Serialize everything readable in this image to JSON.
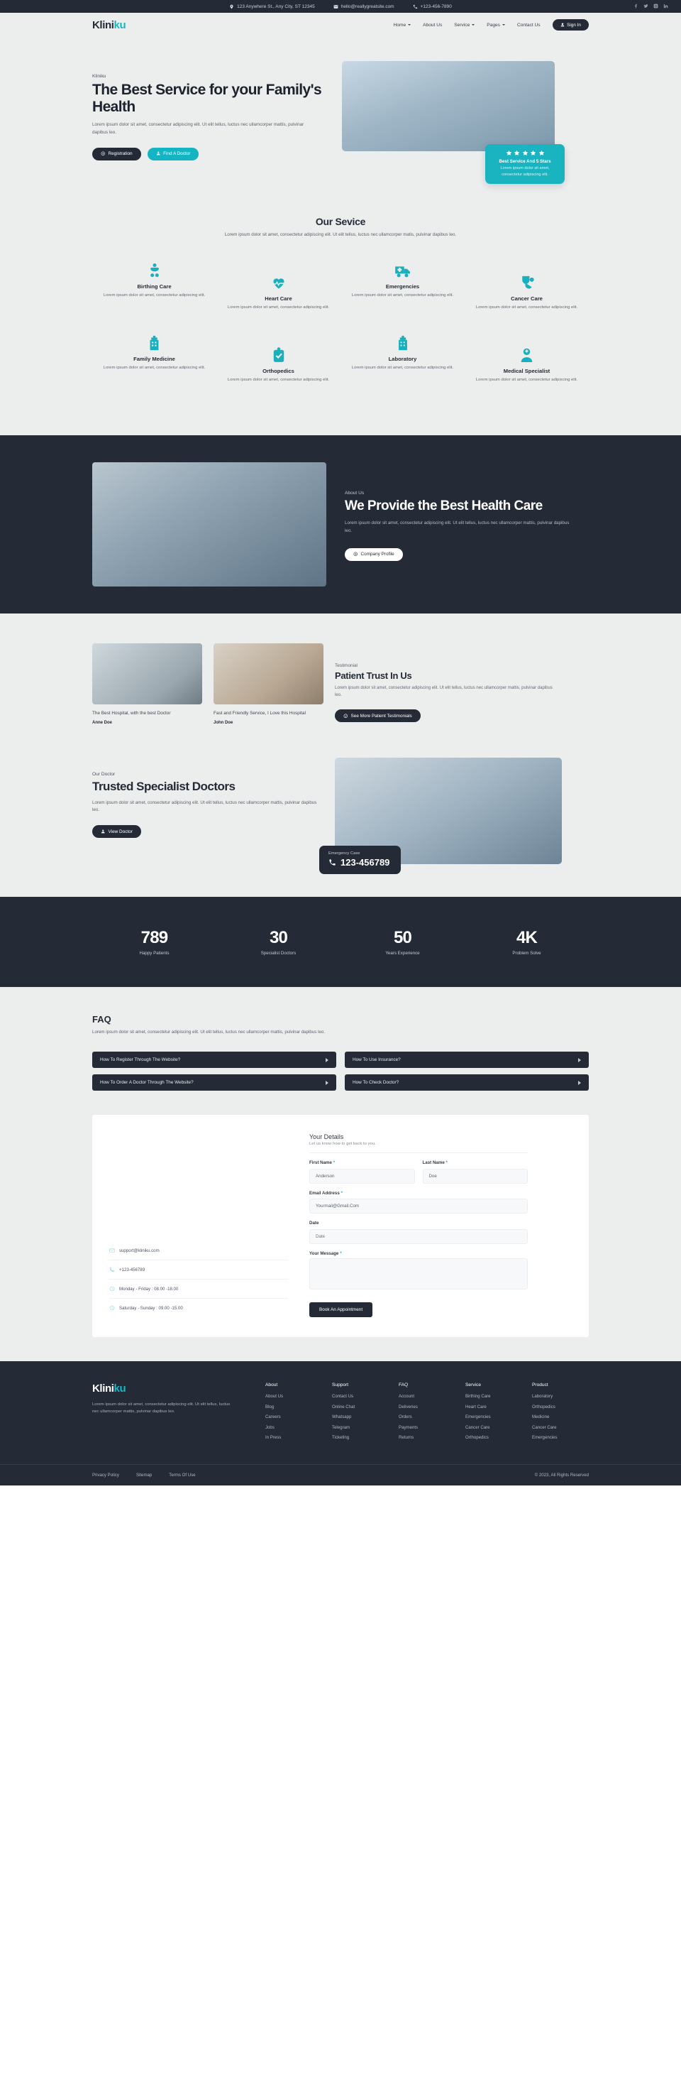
{
  "topbar": {
    "address": "123 Anywhere St., Any City, ST 12345",
    "email": "hello@reallygreatsite.com",
    "phone": "+123-456-7890",
    "socials": [
      "facebook-icon",
      "twitter-icon",
      "instagram-icon",
      "linkedin-icon"
    ]
  },
  "nav": {
    "logo_main": "Klini",
    "logo_accent": "ku",
    "links": [
      {
        "label": "Home",
        "has_dropdown": true
      },
      {
        "label": "About Us",
        "has_dropdown": false
      },
      {
        "label": "Service",
        "has_dropdown": true
      },
      {
        "label": "Pages",
        "has_dropdown": true
      },
      {
        "label": "Contact Us",
        "has_dropdown": false
      }
    ],
    "signin": "Sign In"
  },
  "hero": {
    "eyebrow": "Kliniku",
    "title": "The Best Service for your Family's Health",
    "desc": "Lorem ipsum dolor sit amet, consectetur adipiscing elit. Ut elit tellus, luctus nec ullamcorper mattis, pulvinar dapibus leo.",
    "btn_primary": "Registration",
    "btn_secondary": "Find A Doctor",
    "rating": {
      "stars": 5,
      "title": "Best Service And 5 Stars",
      "desc": "Lorem ipsum dolor sit amet, consectetur adipiscing elit."
    }
  },
  "services": {
    "title": "Our Sevice",
    "subtitle": "Lorem ipsum dolor sit amet, consectetur adipiscing elit. Ut elit tellus, luctus nec ullamcorper matis, pulvinar dapibus leo.",
    "items": [
      {
        "icon": "baby-icon",
        "title": "Birthing Care",
        "desc": "Lorem ipsum dolor sit amet, consectetur adipiscing elit."
      },
      {
        "icon": "heartbeat-icon",
        "title": "Heart Care",
        "desc": "Lorem ipsum dolor sit amet, consectetur adipiscing elit."
      },
      {
        "icon": "ambulance-icon",
        "title": "Emergencies",
        "desc": "Lorem ipsum dolor sit amet, consectetur adipiscing elit."
      },
      {
        "icon": "stethoscope-icon",
        "title": "Cancer Care",
        "desc": "Lorem ipsum dolor sit amet, consectetur adipiscing elit."
      },
      {
        "icon": "hospital-icon",
        "title": "Family Medicine",
        "desc": "Lorem ipsum dolor sit amet, consectetur adipiscing elit."
      },
      {
        "icon": "clipboard-check-icon",
        "title": "Orthopedics",
        "desc": "Lorem ipsum dolor sit amet, consectetur adipiscing elit."
      },
      {
        "icon": "lab-building-icon",
        "title": "Laboratory",
        "desc": "Lorem ipsum dolor sit amet, consectetur adipiscing elit."
      },
      {
        "icon": "doctor-icon",
        "title": "Medical Specialist",
        "desc": "Lorem ipsum dolor sit amet, consectetur adipiscing elit."
      }
    ]
  },
  "about": {
    "eyebrow": "About Us",
    "title": "We Provide the Best Health Care",
    "desc": "Lorem ipsum dolor sit amet, consectetur adipiscing elit. Ut elit tellus, luctus nec ullamcorper mattis, pulvinar dapibus leo.",
    "button": "Company Profile"
  },
  "testimonial": {
    "eyebrow": "Testimonial",
    "title": "Patient Trust In Us",
    "desc": "Lorem ipsum dolor sit amet, consectetur adipiscing elit. Ut elit tellus, luctus nec ullamcorper mattis, pulvinar dapibus leo.",
    "button": "See More Patient Testimonials",
    "cards": [
      {
        "quote": "The Best Hospital, with the best Doctor",
        "name": "Anne Doe"
      },
      {
        "quote": "Fast and Friendly Service, I Love this Hospital",
        "name": "John Doe"
      }
    ]
  },
  "doctors": {
    "eyebrow": "Our Doctor",
    "title": "Trusted Specialist Doctors",
    "desc": "Lorem ipsum dolor sit amet, consectetur adipiscing elit. Ut elit tellus, luctus nec ullamcorper mattis, pulvinar dapibus leo.",
    "button": "View Doctor",
    "emergency_label": "Emergency Case",
    "emergency_number": "123-456789"
  },
  "stats": [
    {
      "value": "789",
      "label": "Happy Patients"
    },
    {
      "value": "30",
      "label": "Specialist Doctors"
    },
    {
      "value": "50",
      "label": "Years Experience"
    },
    {
      "value": "4K",
      "label": "Problem Solve"
    }
  ],
  "faq": {
    "title": "FAQ",
    "desc": "Lorem ipsum dolor sit amet, consectetur adipiscing elit. Ut elit tellus, luctus nec ullamcorper mattis, pulvinar dapibus leo.",
    "items": [
      "How To Register Through The Website?",
      "How To Use Insurance?",
      "How To Order A Doctor Through The Website?",
      "How To Check Doctor?"
    ]
  },
  "appointment": {
    "contacts": [
      {
        "icon": "mail-icon",
        "text": "support@kliniku.com"
      },
      {
        "icon": "phone-icon",
        "text": "+123-456789"
      },
      {
        "icon": "clock-icon",
        "text": "Monday - Friday : 08.00 -18.00"
      },
      {
        "icon": "clock-icon",
        "text": "Saturday - Sunday : 09.00 -15.00"
      }
    ],
    "form_title": "Your Details",
    "form_subtitle": "Let us know how to get back to you.",
    "first_name_label": "First Name",
    "first_name_value": "Anderson",
    "last_name_label": "Last Name",
    "last_name_value": "Doe",
    "email_label": "Email Address",
    "email_value": "Yourmail@Gmail.Com",
    "date_label": "Date",
    "date_value": "Date",
    "message_label": "Your Message",
    "message_value": "",
    "submit": "Book An Appointment"
  },
  "footer": {
    "logo_main": "Klini",
    "logo_accent": "ku",
    "desc": "Lorem ipsum dolor sit amet, consectetur adipiscing elit. Ut elit tellus, luctus nec ullamcorper mattis, pulvinar dapibus leo.",
    "columns": [
      {
        "heading": "About",
        "items": [
          "About Us",
          "Blog",
          "Careers",
          "Jobs",
          "In Press"
        ]
      },
      {
        "heading": "Support",
        "items": [
          "Contact Us",
          "Online Chat",
          "Whatsapp",
          "Telegram",
          "Ticketing"
        ]
      },
      {
        "heading": "FAQ",
        "items": [
          "Account",
          "Deliveries",
          "Orders",
          "Payments",
          "Returns"
        ]
      },
      {
        "heading": "Service",
        "items": [
          "Birthing Care",
          "Heart Care",
          "Emergencies",
          "Cancer Care",
          "Orthopedics"
        ]
      },
      {
        "heading": "Product",
        "items": [
          "Laboratory",
          "Orthopedics",
          "Medicine",
          "Cancer Care",
          "Emergencies"
        ]
      }
    ],
    "bottom_links": [
      "Privacy Policy",
      "Sitemap",
      "Terms Of Use"
    ],
    "copyright": "© 2023, All Rights Reserved"
  },
  "colors": {
    "accent": "#19b4c0",
    "dark": "#252b36",
    "page_bg": "#eceded"
  }
}
